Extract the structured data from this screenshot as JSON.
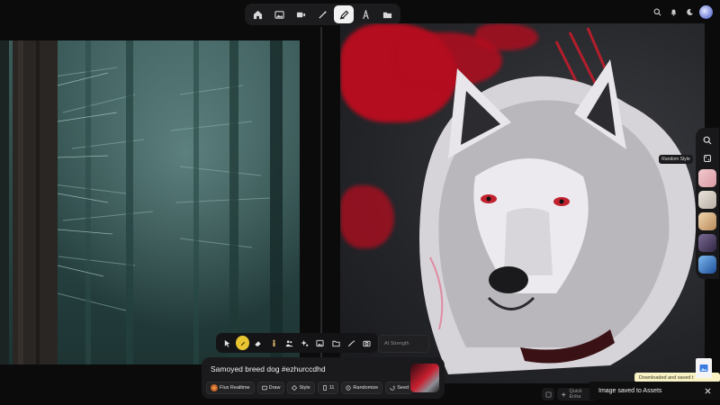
{
  "top_toolbar": {
    "tools": [
      "home-icon",
      "image-icon",
      "video-icon",
      "wand-icon",
      "draw-icon",
      "text-icon",
      "folder-icon"
    ],
    "active_tool": "draw-icon"
  },
  "top_right": {
    "icons": [
      "search-icon",
      "bell-icon",
      "theme-icon",
      "avatar"
    ]
  },
  "right_rail": {
    "tooltip": "Random Style",
    "style_thumbs": [
      "#e9b7bd",
      "#d9d2c9",
      "#d8b38a",
      "#5a4a6a",
      "#3e78c4"
    ]
  },
  "bottom_tools": {
    "items": [
      "cursor-icon",
      "yellow-dot",
      "eraser-icon",
      "figure-icon",
      "people-icon",
      "sparkle-people-icon",
      "image-icon",
      "folder-icon",
      "wand-icon",
      "camera-icon"
    ],
    "ai_strength_placeholder": "AI Strength"
  },
  "prompt": {
    "text": "Samoyed breed dog #ezhurccdhd",
    "model": "Flux Realtime",
    "draw": "Draw",
    "style": "Style",
    "count": "11",
    "randomize": "Randomize",
    "seed": "Seed"
  },
  "bottom_right": {
    "quick_enhance": "Quick Enha",
    "download_tooltip": "Downloaded and saved t",
    "toast": "Image saved to Assets"
  },
  "colors": {
    "accent_active": "#f2f2f2",
    "yellow_tool": "#e9c532",
    "red_splash": "#b30d1f",
    "tooltip_bg": "#f7f1c4"
  }
}
